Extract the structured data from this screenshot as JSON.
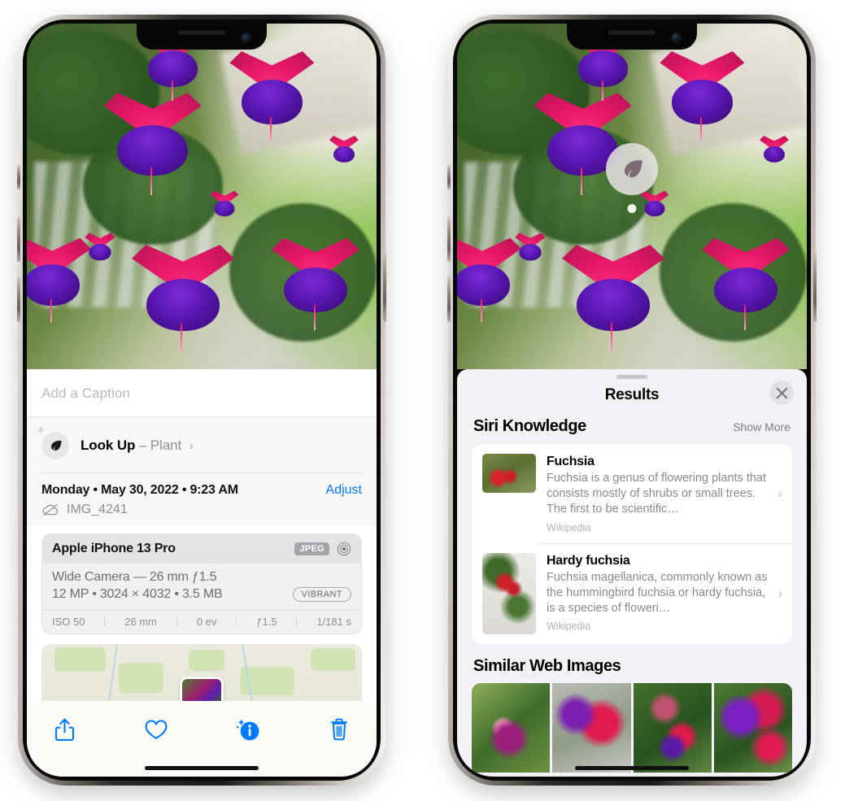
{
  "left_phone": {
    "photo": {
      "alt_name": "fuchsia-flowers-photo"
    },
    "caption_field": {
      "placeholder": "Add a Caption",
      "value": ""
    },
    "lookup_row": {
      "icon": "leaf-icon",
      "sparkle_icon": "sparkle-icon",
      "label": "Look Up",
      "separator": "–",
      "subject": "Plant",
      "chevron": "›"
    },
    "metadata": {
      "date_line": "Monday • May 30, 2022 • 9:23 AM",
      "adjust_label": "Adjust",
      "cloud_icon": "cloud-slash-icon",
      "filename": "IMG_4241"
    },
    "camera_card": {
      "device": "Apple iPhone 13 Pro",
      "format_badge": "JPEG",
      "aperture_icon": "aperture-icon",
      "lens_line": "Wide Camera — 26 mm ƒ1.5",
      "specs_line": "12 MP • 3024 × 4032 • 3.5 MB",
      "style_badge": "VIBRANT",
      "exif": [
        "ISO 50",
        "26 mm",
        "0 ev",
        "ƒ1.5",
        "1/181 s"
      ]
    },
    "map_card": {
      "pin_name": "photo-map-pin"
    },
    "toolbar": [
      {
        "name": "share-button",
        "icon": "share-icon"
      },
      {
        "name": "favorite-button",
        "icon": "heart-icon"
      },
      {
        "name": "info-button",
        "icon": "info-sparkle-icon"
      },
      {
        "name": "delete-button",
        "icon": "trash-icon"
      }
    ]
  },
  "right_phone": {
    "vlu_badge": {
      "icon": "leaf-icon"
    },
    "sheet": {
      "title": "Results",
      "close_icon": "close-icon",
      "siri_section": {
        "title": "Siri Knowledge",
        "show_more": "Show More",
        "items": [
          {
            "title": "Fuchsia",
            "description": "Fuchsia is a genus of flowering plants that consists mostly of shrubs or small trees. The first to be scientific…",
            "source": "Wikipedia",
            "chevron": "›"
          },
          {
            "title": "Hardy fuchsia",
            "description": "Fuchsia magellanica, commonly known as the hummingbird fuchsia or hardy fuchsia, is a species of floweri…",
            "source": "Wikipedia",
            "chevron": "›"
          }
        ]
      },
      "web_section": {
        "title": "Similar Web Images",
        "image_count": 4
      }
    }
  },
  "colors": {
    "accent_blue": "#007aff",
    "sheet_bg": "#f1f1f6",
    "card_bg": "#ffffff",
    "secondary_text": "#8e8e93",
    "panel_bg": "#f7f7f8"
  }
}
